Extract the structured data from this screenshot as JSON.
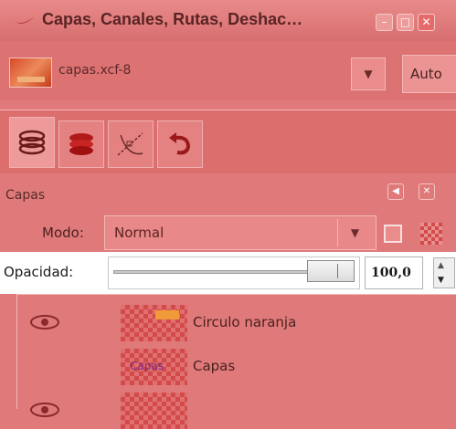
{
  "window": {
    "title": "Capas, Canales, Rutas, Deshac…"
  },
  "image_selector": {
    "name": "capas.xcf-8",
    "auto_label": "Auto"
  },
  "tabs": [
    {
      "name": "layers"
    },
    {
      "name": "channels"
    },
    {
      "name": "paths"
    },
    {
      "name": "undo"
    }
  ],
  "panel": {
    "title": "Capas",
    "mode_label": "Modo:",
    "mode_value": "Normal",
    "opacity_label": "Opacidad:",
    "opacity_value": "100,0"
  },
  "layers": [
    {
      "name": "Circulo naranja",
      "visible": true,
      "thumb_text": ""
    },
    {
      "name": "Capas",
      "visible": false,
      "thumb_text": "Capas"
    },
    {
      "name": "",
      "visible": true,
      "thumb_text": ""
    }
  ],
  "colors": {
    "overlay": "#e07a7a",
    "opacity_strip": "#ffffff"
  }
}
